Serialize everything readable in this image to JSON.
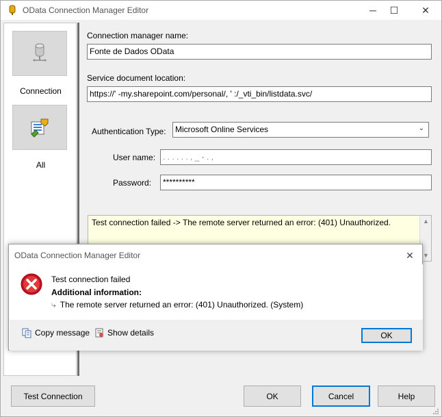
{
  "window": {
    "title": "OData Connection Manager Editor",
    "controls": {
      "minimize": "─",
      "maximize": "☐",
      "close": "✕"
    }
  },
  "nav": {
    "items": [
      {
        "label": "Connection",
        "icon": "database-icon"
      },
      {
        "label": "All",
        "icon": "properties-icon"
      }
    ]
  },
  "form": {
    "conn_name_label": "Connection manager name:",
    "conn_name_value": "Fonte de Dados OData",
    "service_doc_label": "Service document location:",
    "service_doc_value": "https://'            -my.sharepoint.com/personal/,      '                         :/_vti_bin/listdata.svc/",
    "auth_label": "Authentication Type:",
    "auth_value": "Microsoft Online Services",
    "user_label": "User name:",
    "user_value": ". .   . .   .  .  ,  _  -    .  ,",
    "password_label": "Password:",
    "password_value": "**********",
    "result_text": "Test connection failed -> The remote server returned an error: (401) Unauthorized."
  },
  "buttons": {
    "test": "Test Connection",
    "ok": "OK",
    "cancel": "Cancel",
    "help": "Help"
  },
  "dialog": {
    "title": "OData Connection Manager Editor",
    "close": "✕",
    "message": "Test connection failed",
    "additional_label": "Additional information:",
    "detail_arrow": "⤷",
    "detail": "The remote server returned an error: (401) Unauthorized. (System)",
    "copy_label": "Copy message",
    "details_label": "Show details",
    "ok_label": "OK"
  },
  "colors": {
    "accent": "#0078d7",
    "result_bg": "#ffffe1",
    "error_red": "#c50f1f"
  }
}
